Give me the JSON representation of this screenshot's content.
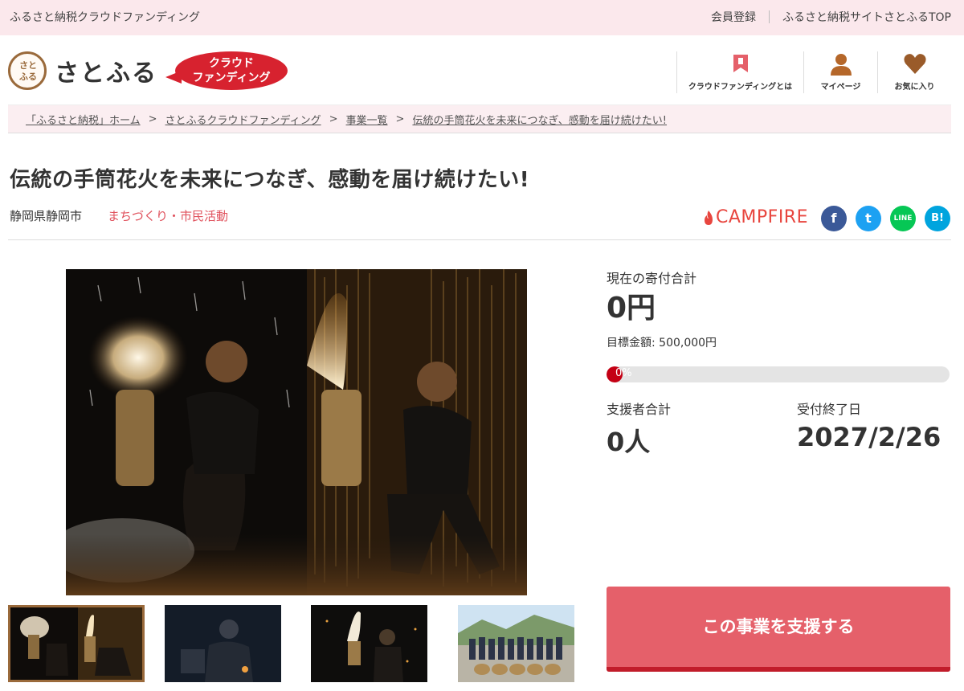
{
  "top": {
    "site_name": "ふるさと納税クラウドファンディング",
    "register_label": "会員登録",
    "top_link_label": "ふるさと納税サイトさとふるTOP"
  },
  "header": {
    "logo_mark_text": "さとふる",
    "logo_text": "さとふる",
    "badge_line1": "クラウド",
    "badge_line2": "ファンディング",
    "nav": [
      {
        "label": "クラウドファンディングとは",
        "icon": "bookmark-icon"
      },
      {
        "label": "マイページ",
        "icon": "person-icon"
      },
      {
        "label": "お気に入り",
        "icon": "heart-icon"
      }
    ]
  },
  "breadcrumb": [
    "「ふるさと納税」ホーム",
    "さとふるクラウドファンディング",
    "事業一覧",
    "伝統の手筒花火を未来につなぎ、感動を届け続けたい!"
  ],
  "breadcrumb_separator": ">",
  "project": {
    "title": "伝統の手筒花火を未来につなぎ、感動を届け続けたい!",
    "region": "静岡県静岡市",
    "category": "まちづくり・市民活動",
    "platform": "CAMPFIRE"
  },
  "share": {
    "facebook": "f",
    "twitter": "t",
    "line": "LINE",
    "hatena": "B!"
  },
  "stats": {
    "current_label": "現在の寄付合計",
    "current_value": "0円",
    "goal_text": "目標金額: 500,000円",
    "progress_label": "0%",
    "progress_fraction": 0,
    "supporters_label": "支援者合計",
    "supporters_value": "0人",
    "deadline_label": "受付終了日",
    "deadline_value": "2027/2/26"
  },
  "cta": {
    "label": "この事業を支援する"
  },
  "colors": {
    "accent_red": "#e5606a",
    "brand_red": "#d7222f",
    "category_pink": "#e0525d",
    "logo_brown": "#9a6a3b",
    "strip_pink": "#fbe8ec"
  }
}
